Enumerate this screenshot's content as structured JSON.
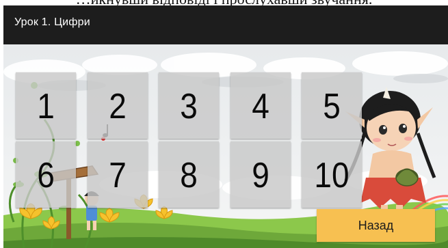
{
  "caption": "…икнувши відповіді і прослухавши звучання.",
  "header": {
    "title": "Урок 1. Цифри"
  },
  "tiles": [
    {
      "label": "1"
    },
    {
      "label": "2"
    },
    {
      "label": "3"
    },
    {
      "label": "4"
    },
    {
      "label": "5"
    },
    {
      "label": "6"
    },
    {
      "label": "7"
    },
    {
      "label": "8"
    },
    {
      "label": "9"
    },
    {
      "label": "10"
    }
  ],
  "back_button": {
    "label": "Назад"
  },
  "colors": {
    "header_bg": "#1d1d1d",
    "tile_bg": "#c8c8c8",
    "button_bg": "#f7c051",
    "grass": "#7cb342",
    "sky": "#eef1f3"
  }
}
